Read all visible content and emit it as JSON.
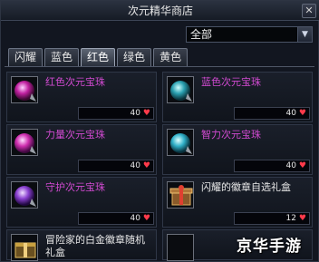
{
  "window": {
    "title": "次元精华商店",
    "close_label": "✕"
  },
  "filter": {
    "selected": "全部",
    "arrow": "▼"
  },
  "tabs": [
    {
      "label": "闪耀",
      "active": false
    },
    {
      "label": "蓝色",
      "active": false
    },
    {
      "label": "红色",
      "active": true
    },
    {
      "label": "绿色",
      "active": false
    },
    {
      "label": "黄色",
      "active": false
    }
  ],
  "items": [
    {
      "name": "红色次元宝珠",
      "price": "40",
      "color": "#d04ad0",
      "icon": "red-orb-icon"
    },
    {
      "name": "蓝色次元宝珠",
      "price": "40",
      "color": "#d04ad0",
      "icon": "blue-orb-icon"
    },
    {
      "name": "力量次元宝珠",
      "price": "40",
      "color": "#d04ad0",
      "icon": "pink-orb-icon"
    },
    {
      "name": "智力次元宝珠",
      "price": "40",
      "color": "#d04ad0",
      "icon": "cyan-orb-icon"
    },
    {
      "name": "守护次元宝珠",
      "price": "40",
      "color": "#d04ad0",
      "icon": "purple-orb-icon"
    },
    {
      "name": "闪耀的徽章自选礼盒",
      "price": "12",
      "color": "#e8e8e8",
      "icon": "gift-box-icon"
    },
    {
      "name": "冒险家的白金徽章随机礼盒",
      "price": "",
      "color": "#e8e8e8",
      "icon": "platinum-box-icon"
    }
  ],
  "watermark": "京华手游",
  "price_icon": "heart-icon",
  "colors": {
    "accent": "#d04ad0",
    "heart": "#ff3a4a"
  }
}
